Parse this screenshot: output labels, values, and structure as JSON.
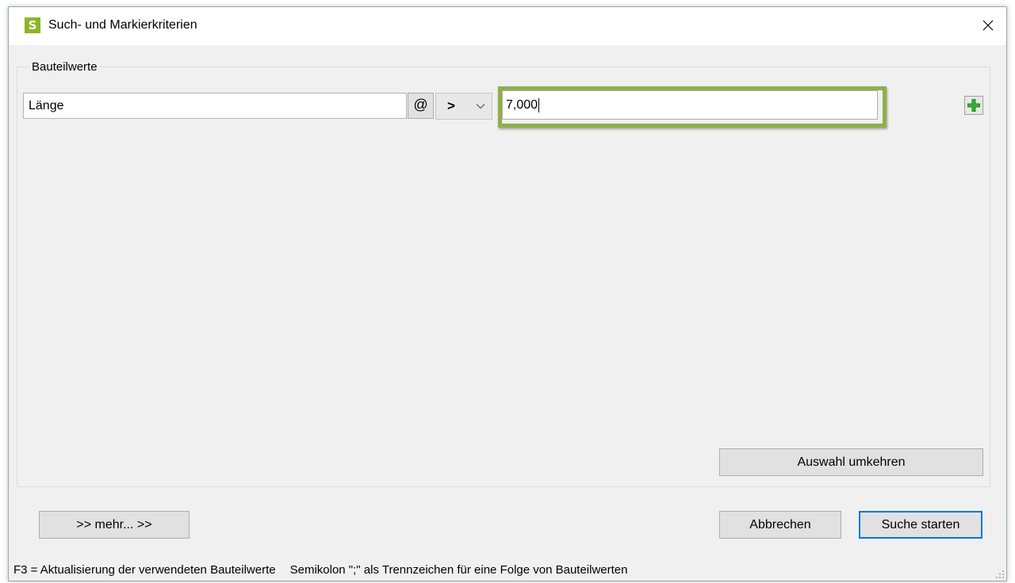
{
  "window": {
    "title": "Such- und Markierkriterien",
    "app_icon_letter": "S",
    "accent_color": "#8ab52a"
  },
  "group": {
    "label": "Bauteilwerte"
  },
  "criteria_row": {
    "field_value": "Länge",
    "at_button_label": "@",
    "operator_value": ">",
    "value": "7,000",
    "add_icon": "plus-icon"
  },
  "buttons": {
    "invert_label": "Auswahl umkehren",
    "more_label": ">>  mehr...  >>",
    "cancel_label": "Abbrechen",
    "start_label": "Suche starten"
  },
  "statusbar": {
    "hint_f3": "F3 = Aktualisierung der verwendeten Bauteilwerte",
    "hint_semicolon": "Semikolon \";\" als Trennzeichen für eine Folge von Bauteilwerten"
  }
}
